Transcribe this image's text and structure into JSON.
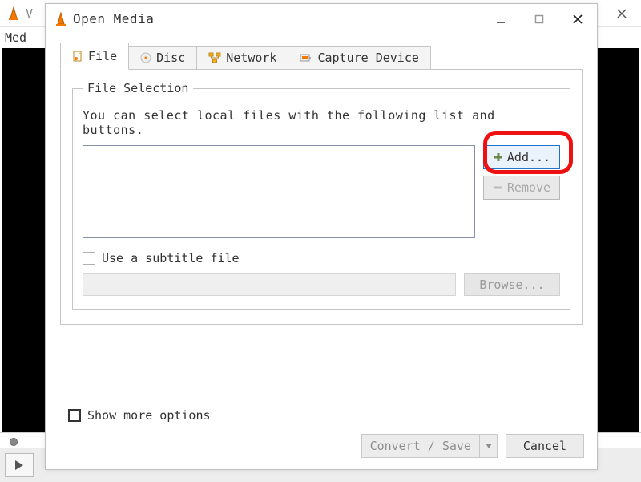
{
  "bg": {
    "menu_media": "Med",
    "title_partial": "V"
  },
  "dialog": {
    "title": "Open Media",
    "tabs": {
      "file": "File",
      "disc": "Disc",
      "network": "Network",
      "capture": "Capture Device"
    },
    "file_selection": {
      "legend": "File Selection",
      "help": "You can select local files with the following list and buttons.",
      "add_label": "Add...",
      "remove_label": "Remove"
    },
    "subtitle": {
      "checkbox_label": "Use a subtitle file",
      "browse_label": "Browse..."
    },
    "show_more": "Show more options",
    "footer": {
      "convert_save": "Convert / Save",
      "cancel": "Cancel"
    }
  }
}
